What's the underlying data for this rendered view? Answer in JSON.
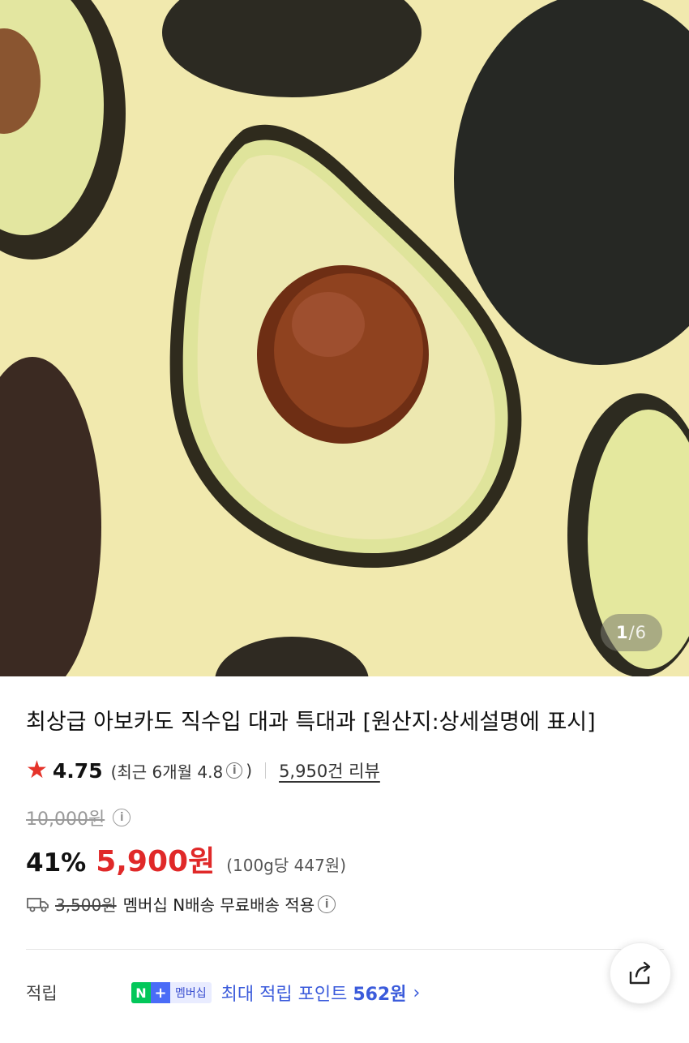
{
  "gallery": {
    "current": "1",
    "separator": "/",
    "total": "6"
  },
  "product": {
    "title": "최상급 아보카도 직수입 대과 특대과 [원산지:상세설명에 표시]"
  },
  "rating": {
    "value": "4.75",
    "recent_open": "(최근 6개월 4.8",
    "recent_close": ")",
    "reviews": "5,950건 리뷰"
  },
  "price": {
    "original": "10,000원",
    "discount": "41%",
    "sale": "5,900원",
    "unit": "(100g당 447원)"
  },
  "shipping": {
    "fee": "3,500원",
    "text": "멤버십 N배송 무료배송 적용"
  },
  "points": {
    "label": "적립",
    "badge_n": "N",
    "badge_plus": "+",
    "badge_membership": "멤버십",
    "text_prefix": "최대 적립 포인트 ",
    "amount": "562원"
  },
  "icons": {
    "rating": "star-icon",
    "info": "info-icon",
    "shipping": "truck-icon",
    "share": "share-icon",
    "chevron": "chevron-right-icon"
  },
  "colors": {
    "price_red": "#e02929",
    "star_red": "#e5332a",
    "points_blue": "#3b5bdb",
    "naver_green": "#03c75a"
  }
}
